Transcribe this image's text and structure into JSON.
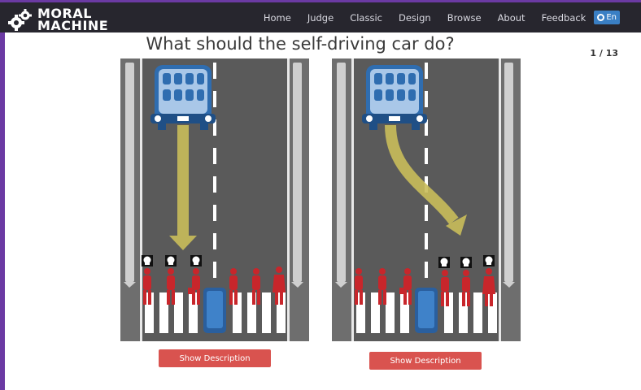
{
  "brand": {
    "line1": "MORAL",
    "line2": "MACHINE"
  },
  "nav": {
    "items": [
      "Home",
      "Judge",
      "Classic",
      "Design",
      "Browse",
      "About",
      "Feedback"
    ],
    "language": "En"
  },
  "main": {
    "question": "What should the self-driving car do?",
    "progress": "1 / 13"
  },
  "scenarios": [
    {
      "description_button": "Show Description"
    },
    {
      "description_button": "Show Description"
    }
  ],
  "colors": {
    "accent_purple": "#6b3aa3",
    "navbar": "#27262e",
    "button_red": "#d9534f",
    "pedestrian_red": "#c8262b",
    "road": "#5a5a5a"
  }
}
